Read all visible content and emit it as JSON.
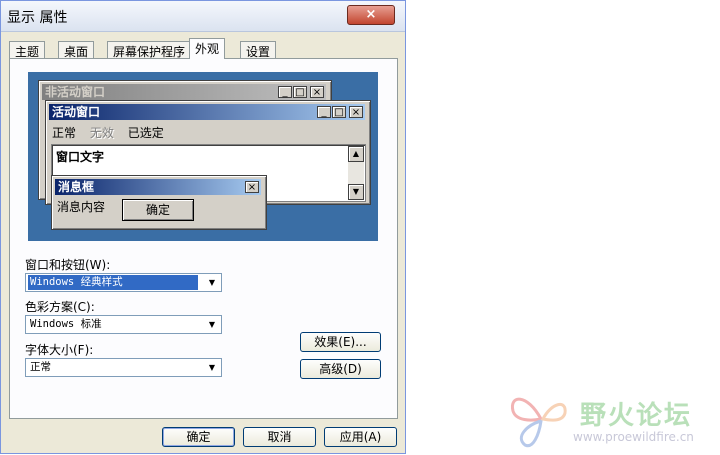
{
  "window": {
    "title": "显示 属性",
    "close_label": "×"
  },
  "tabs": [
    {
      "label": "主题"
    },
    {
      "label": "桌面"
    },
    {
      "label": "屏幕保护程序"
    },
    {
      "label": "外观",
      "active": true
    },
    {
      "label": "设置"
    }
  ],
  "preview": {
    "inactive_title": "非活动窗口",
    "active_title": "活动窗口",
    "menu": {
      "normal": "正常",
      "disabled": "无效",
      "selected": "已选定"
    },
    "window_text": "窗口文字",
    "msgbox_title": "消息框",
    "msgbox_text": "消息内容",
    "msgbox_ok": "确定"
  },
  "form": {
    "windows_buttons_label": "窗口和按钮(W):",
    "windows_buttons_value": "Windows 经典样式",
    "color_scheme_label": "色彩方案(C):",
    "color_scheme_value": "Windows 标准",
    "font_size_label": "字体大小(F):",
    "font_size_value": "正常",
    "effects_button": "效果(E)...",
    "advanced_button": "高级(D)"
  },
  "footer": {
    "ok": "确定",
    "cancel": "取消",
    "apply": "应用(A)"
  },
  "watermark": {
    "text": "野火论坛",
    "url": "www.proewildfire.cn"
  },
  "colors": {
    "desktop": "#3a6ea5",
    "active_title": "#0a246a",
    "dialog_bg": "#ece9d8"
  }
}
